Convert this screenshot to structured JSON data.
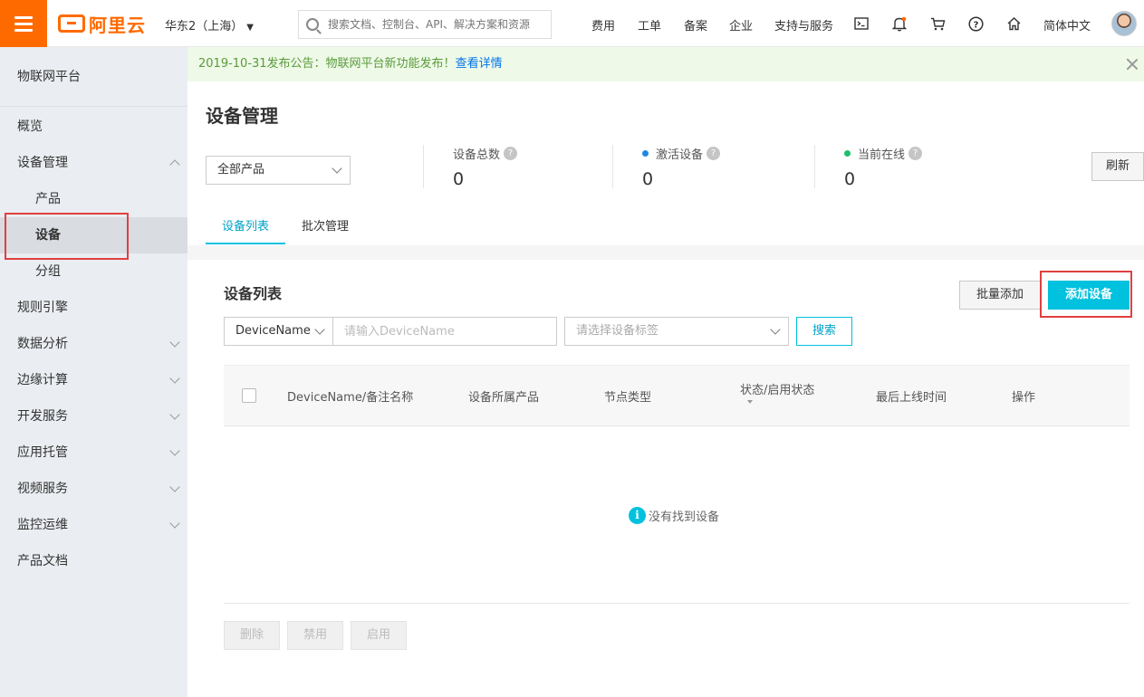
{
  "header": {
    "logo_text": "阿里云",
    "region": "华东2（上海）",
    "search_placeholder": "搜索文档、控制台、API、解决方案和资源",
    "nav": [
      "费用",
      "工单",
      "备案",
      "企业",
      "支持与服务"
    ],
    "icons": [
      "terminal-icon",
      "bell-icon",
      "cart-icon",
      "help-icon",
      "home-icon"
    ],
    "language": "简体中文",
    "accent": "#ff6a00"
  },
  "sidebar": {
    "title": "物联网平台",
    "items": [
      {
        "label": "概览",
        "level": 1,
        "chevron": "none"
      },
      {
        "label": "设备管理",
        "level": 1,
        "chevron": "up"
      },
      {
        "label": "产品",
        "level": 2,
        "chevron": "none"
      },
      {
        "label": "设备",
        "level": 2,
        "chevron": "none",
        "active": true
      },
      {
        "label": "分组",
        "level": 2,
        "chevron": "none"
      },
      {
        "label": "规则引擎",
        "level": 1,
        "chevron": "none"
      },
      {
        "label": "数据分析",
        "level": 1,
        "chevron": "down"
      },
      {
        "label": "边缘计算",
        "level": 1,
        "chevron": "down"
      },
      {
        "label": "开发服务",
        "level": 1,
        "chevron": "down"
      },
      {
        "label": "应用托管",
        "level": 1,
        "chevron": "down"
      },
      {
        "label": "视频服务",
        "level": 1,
        "chevron": "down"
      },
      {
        "label": "监控运维",
        "level": 1,
        "chevron": "down"
      },
      {
        "label": "产品文档",
        "level": 1,
        "chevron": "none"
      }
    ]
  },
  "notice": {
    "text": "2019-10-31发布公告：物联网平台新功能发布！",
    "link": "查看详情"
  },
  "page": {
    "title": "设备管理",
    "product_select": "全部产品",
    "stats": [
      {
        "label": "设备总数",
        "value": "0",
        "dot_color": ""
      },
      {
        "label": "激活设备",
        "value": "0",
        "dot_color": "#1e88e5"
      },
      {
        "label": "当前在线",
        "value": "0",
        "dot_color": "#1fbf6a"
      }
    ],
    "refresh": "刷新",
    "tabs": [
      {
        "label": "设备列表",
        "active": true
      },
      {
        "label": "批次管理",
        "active": false
      }
    ]
  },
  "panel": {
    "title": "设备列表",
    "batch_add": "批量添加",
    "add_device": "添加设备",
    "filter_field": "DeviceName",
    "name_placeholder": "请输入DeviceName",
    "tag_placeholder": "请选择设备标签",
    "search": "搜索",
    "columns": [
      "DeviceName/备注名称",
      "设备所属产品",
      "节点类型",
      "状态/启用状态",
      "最后上线时间",
      "操作"
    ],
    "empty": "没有找到设备",
    "bottom_buttons": [
      "删除",
      "禁用",
      "启用"
    ]
  }
}
